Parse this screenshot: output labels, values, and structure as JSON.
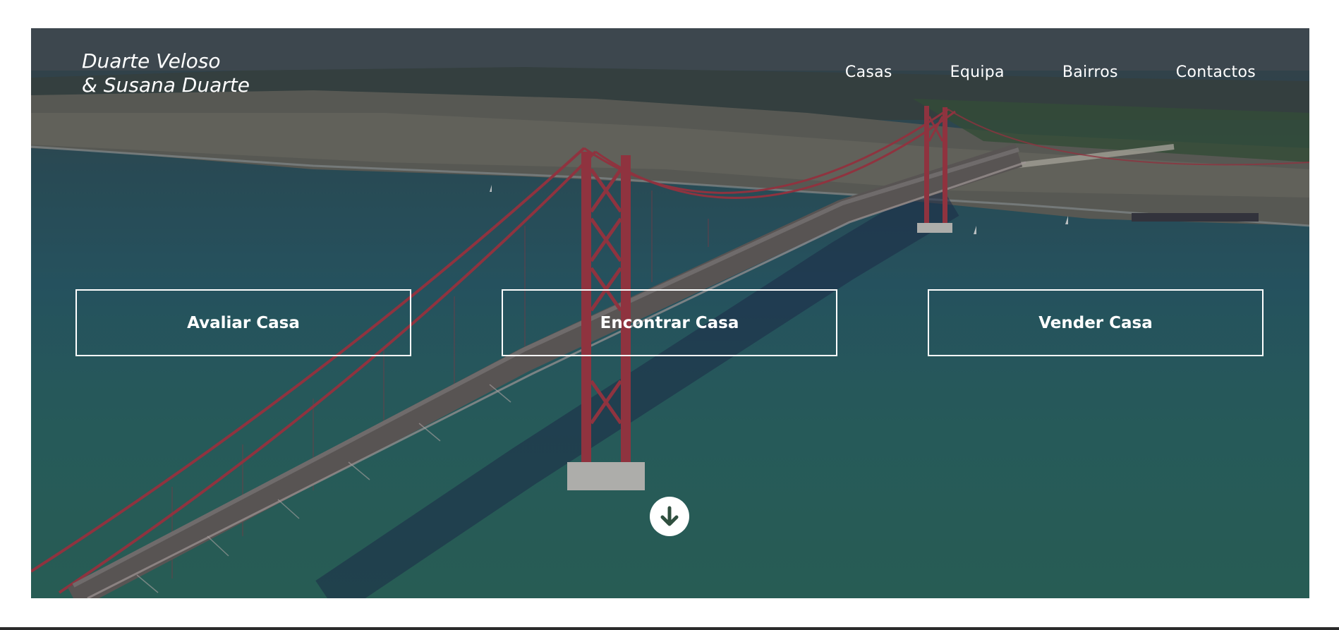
{
  "brand": {
    "line1": "Duarte Veloso",
    "line2": "& Susana Duarte"
  },
  "nav": {
    "items": [
      {
        "label": "Casas"
      },
      {
        "label": "Equipa"
      },
      {
        "label": "Bairros"
      },
      {
        "label": "Contactos"
      }
    ]
  },
  "actions": {
    "evaluate_label": "Avaliar Casa",
    "find_label": "Encontrar Casa",
    "sell_label": "Vender Casa"
  },
  "icons": {
    "scroll": "arrow-down-circle-icon"
  },
  "colors": {
    "bridge_red": "#b23a48",
    "water": "#2c6a6a",
    "white": "#ffffff"
  }
}
